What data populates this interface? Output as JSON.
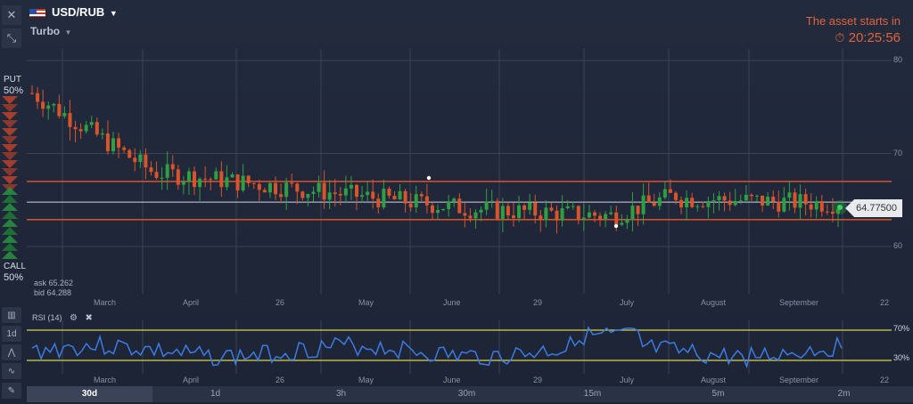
{
  "toolbar": {
    "close_icon": "close-icon",
    "collapse_icon": "collapse-icon",
    "asset": "USD/RUB",
    "mode": "Turbo"
  },
  "timer": {
    "label": "The asset starts in",
    "time": "20:25:56"
  },
  "sentiment": {
    "put_label": "PUT",
    "put_pct": "50%",
    "call_label": "CALL",
    "call_pct": "50%"
  },
  "quote": {
    "price": "64.77500",
    "ask": "ask 65.262",
    "bid": "bid 64.288"
  },
  "chart_data": {
    "type": "candlestick",
    "y_ticks": [
      "80",
      "70",
      "60"
    ],
    "x_ticks": [
      "March",
      "April",
      "26",
      "May",
      "June",
      "29",
      "July",
      "August",
      "September",
      "22"
    ],
    "current_price": 64.775,
    "upper_level": 67.0,
    "lower_level": 62.9,
    "colors": {
      "up": "#2ea043",
      "down": "#d9542b",
      "level": "#d9542b",
      "price_line": "#cfd4dd"
    }
  },
  "rsi": {
    "label": "RSI (14)",
    "upper": "70%",
    "lower": "30%",
    "x_ticks": [
      "March",
      "April",
      "26",
      "May",
      "June",
      "29",
      "July",
      "August",
      "September",
      "22"
    ]
  },
  "side_tools": [
    "bars-icon",
    "1d",
    "indicator-icon",
    "line-icon",
    "pencil-icon"
  ],
  "timeframes": [
    "30d",
    "1d",
    "3h",
    "30m",
    "15m",
    "5m",
    "2m"
  ],
  "active_timeframe": "30d"
}
